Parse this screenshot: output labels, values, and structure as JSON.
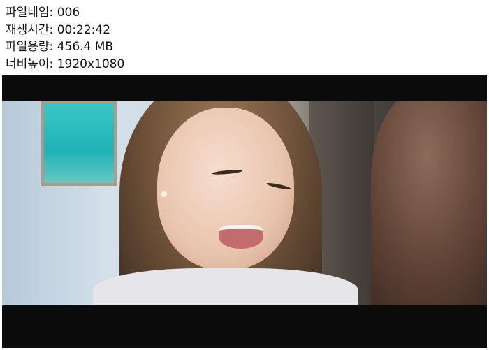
{
  "info": {
    "filename": "파일네임: 006",
    "duration": "재생시간: 00:22:42",
    "filesize": "파일용량: 456.4 MB",
    "resolution": "너비높이: 1920x1080"
  }
}
